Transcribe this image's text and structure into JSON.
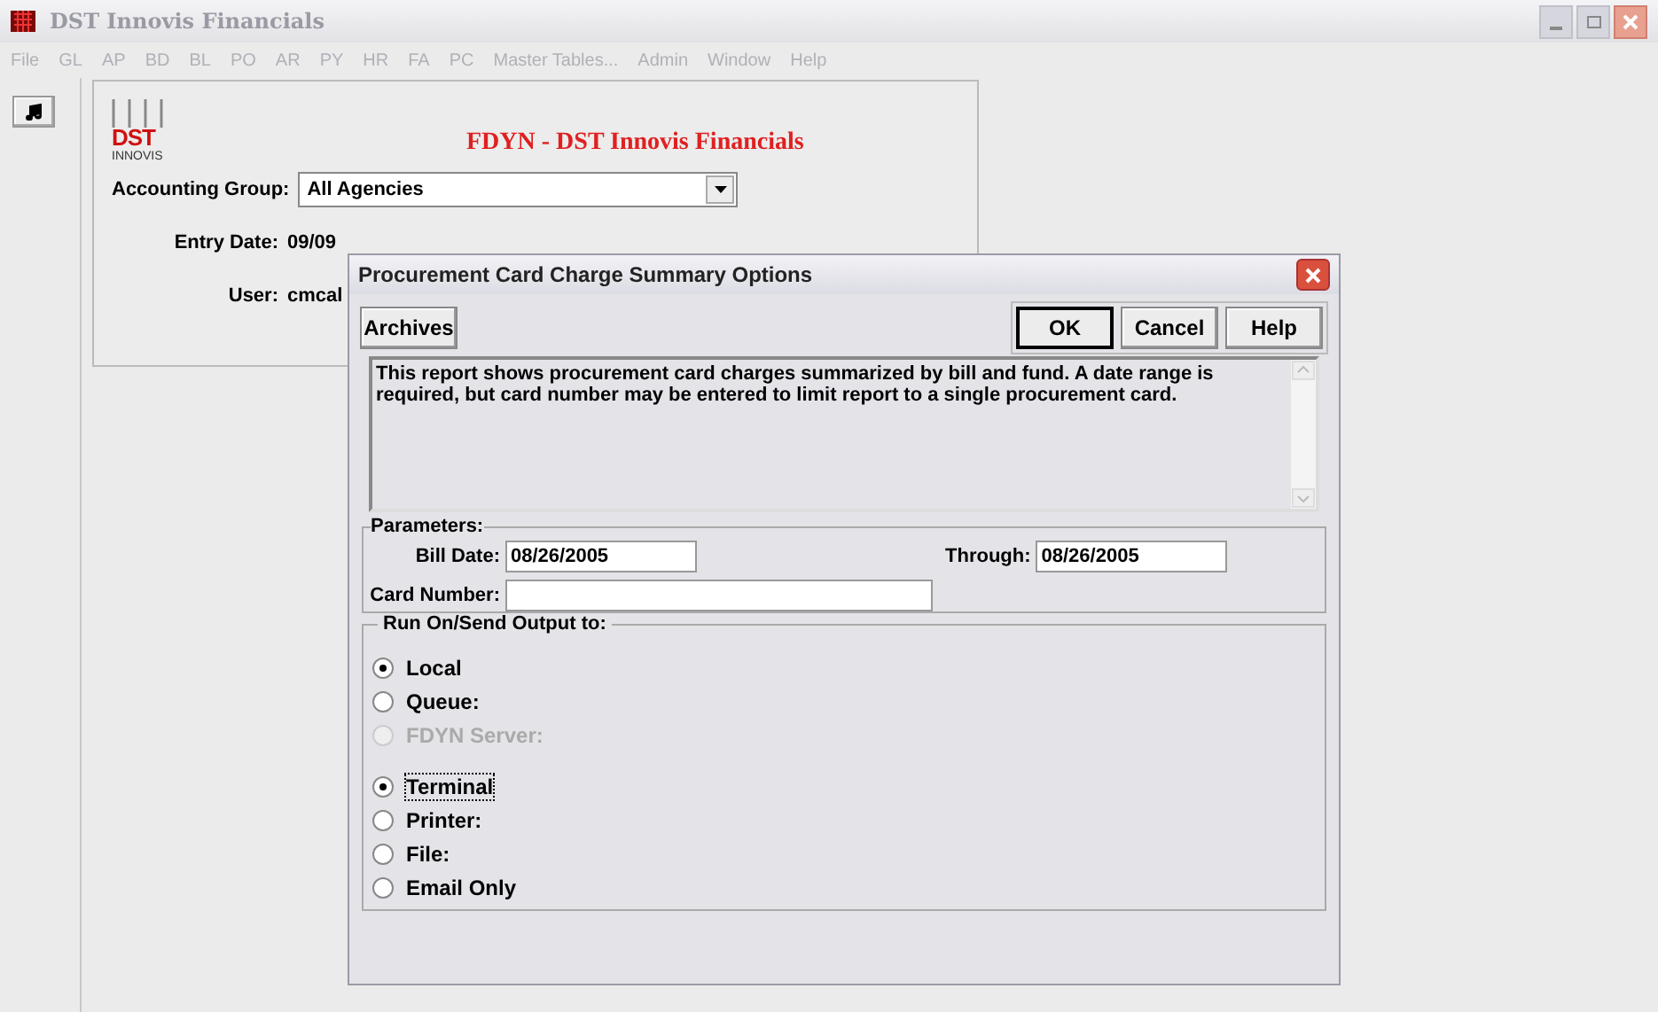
{
  "window": {
    "title": "DST Innovis Financials"
  },
  "menu": [
    "File",
    "GL",
    "AP",
    "BD",
    "BL",
    "PO",
    "AR",
    "PY",
    "HR",
    "FA",
    "PC",
    "Master Tables...",
    "Admin",
    "Window",
    "Help"
  ],
  "form": {
    "logo": {
      "name": "DST",
      "sub": "INNOVIS"
    },
    "heading": "FDYN - DST Innovis Financials",
    "fields": [
      {
        "kind": "combo",
        "label": "Accounting Group:",
        "value": "All Agencies"
      },
      {
        "kind": "text",
        "label": "Entry Date:",
        "value": "09/09"
      },
      {
        "kind": "text",
        "label": "User:",
        "value": "cmcal"
      }
    ]
  },
  "dialog": {
    "title": "Procurement Card Charge Summary Options",
    "left_buttons": [
      {
        "label": "Archives",
        "default": false
      }
    ],
    "right_buttons": [
      {
        "label": "OK",
        "default": true
      },
      {
        "label": "Cancel",
        "default": false
      },
      {
        "label": "Help",
        "default": false
      }
    ],
    "description": "This report shows procurement card charges summarized by bill and fund.  A date range is required, but card number may be entered to limit report to a single procurement card.",
    "parameters": {
      "title": "Parameters:",
      "bill_date": {
        "label": "Bill Date:",
        "value": "08/26/2005"
      },
      "through": {
        "label": "Through:",
        "value": "08/26/2005"
      },
      "card_number": {
        "label": "Card Number:"
      }
    },
    "output": {
      "title": "Run On/Send Output to:",
      "groups": [
        {
          "options": [
            {
              "label": "Local",
              "selected": true,
              "disabled": false,
              "focused": false
            },
            {
              "label": "Queue:",
              "selected": false,
              "disabled": false,
              "focused": false
            },
            {
              "label": "FDYN Server:",
              "selected": false,
              "disabled": true,
              "focused": false
            }
          ]
        },
        {
          "options": [
            {
              "label": "Terminal",
              "selected": true,
              "disabled": false,
              "focused": true
            },
            {
              "label": "Printer:",
              "selected": false,
              "disabled": false,
              "focused": false
            },
            {
              "label": "File:",
              "selected": false,
              "disabled": false,
              "focused": false
            },
            {
              "label": "Email Only",
              "selected": false,
              "disabled": false,
              "focused": false
            }
          ]
        }
      ]
    }
  }
}
